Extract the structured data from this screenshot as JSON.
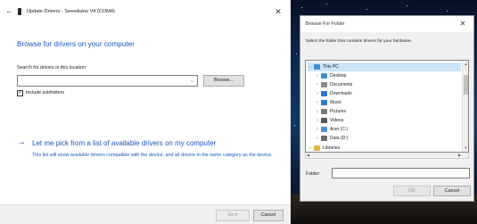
{
  "wizard": {
    "back_glyph": "←",
    "title": "Update Drivers - Seeeduino V4 (COM4)",
    "close_glyph": "✕",
    "heading": "Browse for drivers on your computer",
    "search_label": "Search for drivers in this location:",
    "path_value": "",
    "browse_label": "Browse...",
    "include_subfolders_checked": true,
    "include_subfolders_label": "Include subfolders",
    "pick_link": "Let me pick from a list of available drivers on my computer",
    "pick_description": "This list will show available drivers compatible with the device, and all drivers in the same category as the device.",
    "next_label": "Next",
    "cancel_label": "Cancel",
    "icons": [
      "back-arrow-icon",
      "device-icon",
      "close-icon",
      "chevron-down-icon",
      "right-arrow-icon"
    ]
  },
  "browse_dialog": {
    "title": "Browse For Folder",
    "close_glyph": "✕",
    "instruction": "Select the folder that contains drivers for your hardware.",
    "tree": [
      {
        "label": "This PC",
        "expanded": true,
        "selected": true,
        "icon": "computer-icon",
        "color": "#3c8fd6"
      },
      {
        "label": "Desktop",
        "icon": "desktop-folder-icon",
        "color": "#3c8fd6"
      },
      {
        "label": "Documents",
        "icon": "documents-folder-icon",
        "color": "#8a8a8a"
      },
      {
        "label": "Downloads",
        "icon": "downloads-folder-icon",
        "color": "#2b78d4"
      },
      {
        "label": "Music",
        "icon": "music-folder-icon",
        "color": "#2b78d4"
      },
      {
        "label": "Pictures",
        "icon": "pictures-folder-icon",
        "color": "#7a7a7a"
      },
      {
        "label": "Videos",
        "icon": "videos-folder-icon",
        "color": "#5a5a5a"
      },
      {
        "label": "Acer (C:)",
        "icon": "drive-icon",
        "color": "#4a90d9"
      },
      {
        "label": "Data (D:)",
        "icon": "drive-icon",
        "color": "#6a6a6a"
      },
      {
        "label": "Libraries",
        "icon": "libraries-icon",
        "color": "#e3b341"
      }
    ],
    "folder_label": "Folder:",
    "folder_value": "",
    "ok_label": "OK",
    "cancel_label": "Cancel"
  },
  "colors": {
    "link_blue": "#1a56c4",
    "selection": "#cce4f7"
  }
}
